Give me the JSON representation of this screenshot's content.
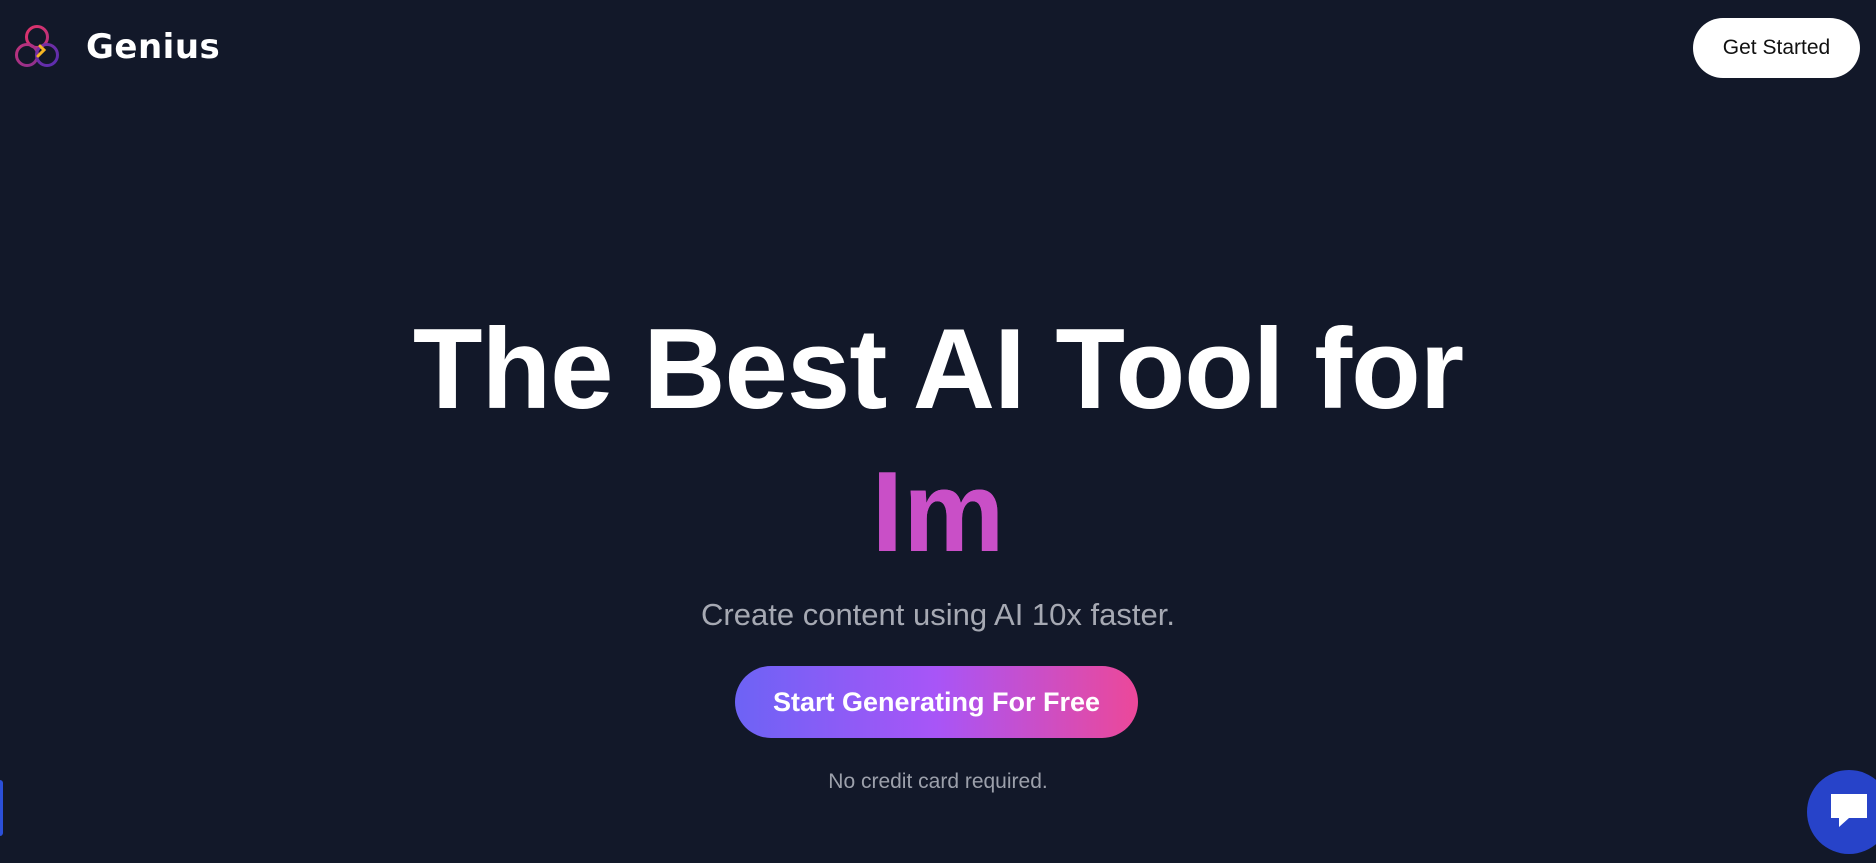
{
  "header": {
    "brand_name": "Genius",
    "logo_icon": "genius-logo-icon",
    "get_started_label": "Get Started"
  },
  "hero": {
    "title_line1": "The Best AI Tool for",
    "title_line2": "Im",
    "subtitle": "Create content using AI 10x faster.",
    "cta_label": "Start Generating For Free",
    "note": "No credit card required."
  },
  "widgets": {
    "chat_icon": "chat-bubble-icon"
  },
  "colors": {
    "background": "#121829",
    "accent_pink": "#c94fc7",
    "cta_gradient_start": "#6d63f5",
    "cta_gradient_mid": "#a855f7",
    "cta_gradient_end": "#ec4899",
    "chat_widget": "#2743c9"
  }
}
